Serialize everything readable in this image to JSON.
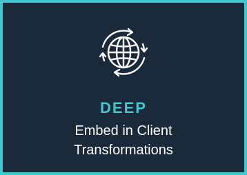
{
  "card": {
    "icon": "globe-with-circular-arrows-icon",
    "heading": "DEEP",
    "subtitle_line1": "Embed in Client",
    "subtitle_line2": "Transformations"
  },
  "colors": {
    "background": "#1b2a3b",
    "border": "#3fc8cf",
    "accent": "#3fc8cf",
    "text": "#ffffff"
  }
}
